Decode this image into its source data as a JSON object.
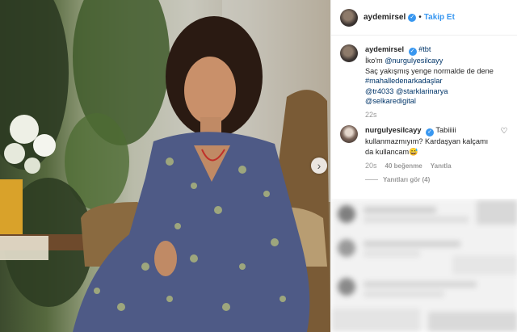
{
  "post": {
    "author": "aydemirsel",
    "follow_label": "Takip Et",
    "dot": "•",
    "verified_mark": "✓",
    "carousel_next_icon": "›"
  },
  "caption": {
    "username": "aydemirsel",
    "hashtag_first": "#tbt",
    "line1_prefix": "İko'm ",
    "mention": "@nurgulyesilcayy",
    "line2": "Saç yakışmış yenge normalde de dene",
    "hashtag_2": "#mahalledenarkadaşlar",
    "mention_2": "@tr4033",
    "mention_3": "@starklarinarya",
    "mention_4": "@selkaredigital",
    "time": "22s"
  },
  "comment": {
    "username": "nurgulyesilcayy",
    "text": "Tabiiiii kullanmazmıyım? Kardaşyan kalçamı da kullancam😅",
    "time": "20s",
    "likes": "40 beğenme",
    "reply_label": "Yanıtla",
    "replies_label": "Yanıtları gör (4)",
    "heart_icon": "♡"
  },
  "colors": {
    "link": "#003569",
    "accent": "#3897f0",
    "meta_gray": "#999999"
  }
}
